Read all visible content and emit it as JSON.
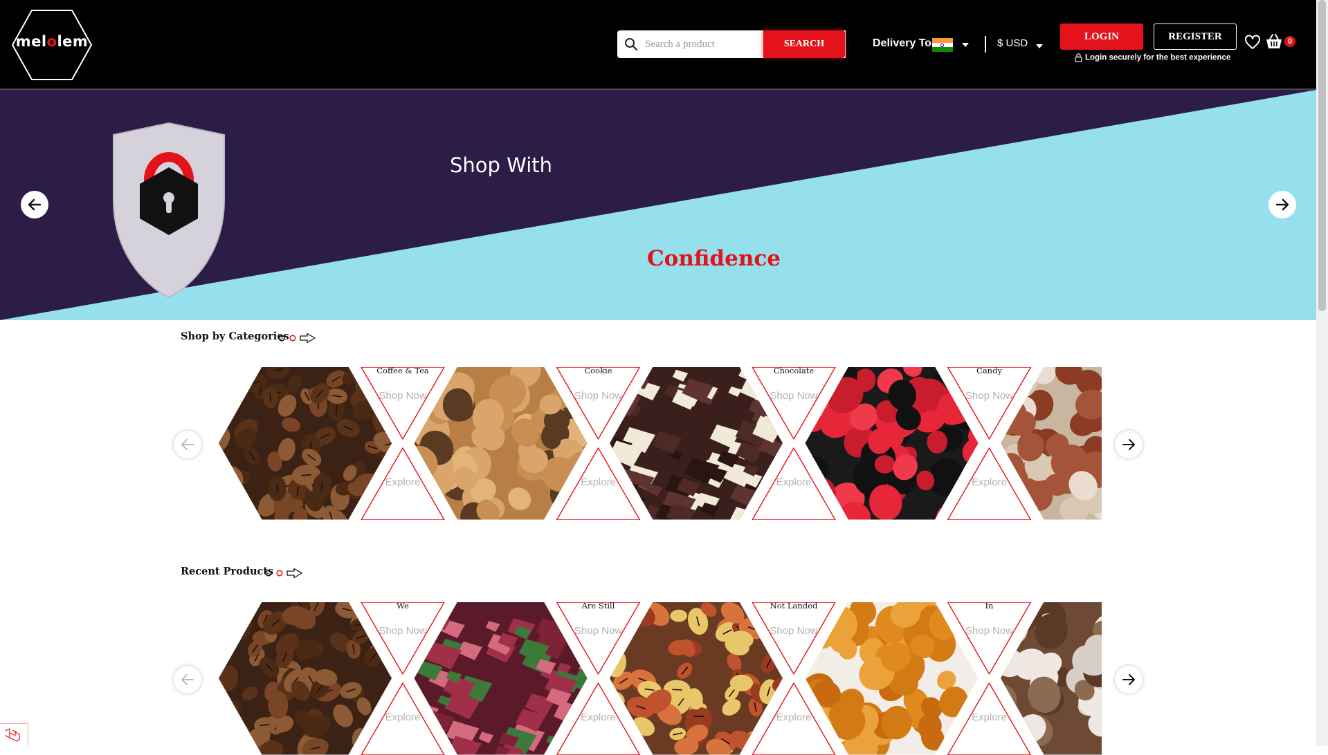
{
  "header": {
    "logo": {
      "text_before": "mel",
      "text_dot": "o",
      "text_after": "lem"
    },
    "search": {
      "placeholder": "Search a product",
      "button_label": "SEARCH"
    },
    "delivery_label": "Delivery To:",
    "delivery_country_flag": "india-flag",
    "currency": "$ USD",
    "login_label": "LOGIN",
    "register_label": "REGISTER",
    "login_note": "Login securely for the best experience",
    "cart_count": "0",
    "accent_color": "#e3121b"
  },
  "banner": {
    "line1": "Shop With",
    "line2": "Confidence",
    "colors": {
      "dark": "#2b1d45",
      "light": "#96e0ee",
      "accent": "#e3121b"
    }
  },
  "categories": {
    "title": "Shop by Categories",
    "link_top": "Shop Now",
    "link_bottom": "Explore",
    "items": [
      {
        "name": "Coffee & Tea",
        "image": "coffee-beans"
      },
      {
        "name": "Cookie",
        "image": "cookies"
      },
      {
        "name": "Chocolate",
        "image": "chocolate"
      },
      {
        "name": "Candy",
        "image": "raspberry-candy"
      },
      {
        "name": "",
        "image": "seeds"
      }
    ]
  },
  "recent": {
    "title": "Recent Products",
    "link_top": "Shop Now",
    "link_bottom": "Explore",
    "items": [
      {
        "name": "We",
        "image": "coffee-beans"
      },
      {
        "name": "Are Still",
        "image": "rose-turkish-delight"
      },
      {
        "name": "Not Landed",
        "image": "turkish-delight-candies"
      },
      {
        "name": "In",
        "image": "turmeric-powder"
      },
      {
        "name": "",
        "image": "truffles"
      }
    ]
  }
}
